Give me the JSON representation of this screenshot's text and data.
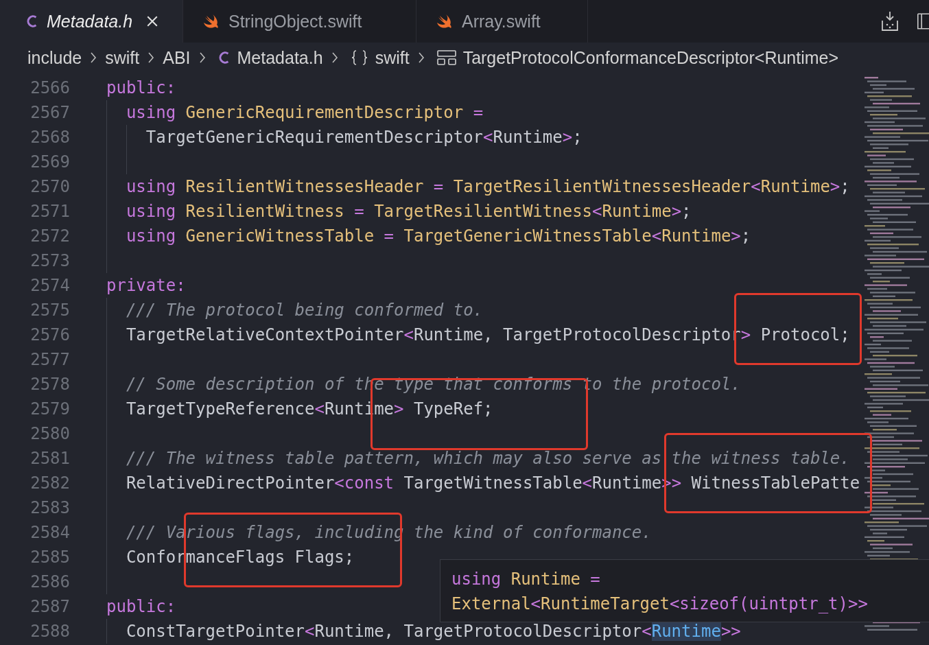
{
  "tabs": [
    {
      "label": "Metadata.h",
      "kind": "c-file",
      "selected": true
    },
    {
      "label": "StringObject.swift",
      "kind": "swift-file",
      "selected": false
    },
    {
      "label": "Array.swift",
      "kind": "swift-file",
      "selected": false
    }
  ],
  "breadcrumb": [
    {
      "label": "include",
      "kind": "folder"
    },
    {
      "label": "swift",
      "kind": "folder"
    },
    {
      "label": "ABI",
      "kind": "folder"
    },
    {
      "label": "Metadata.h",
      "kind": "c-file"
    },
    {
      "label": "swift",
      "kind": "namespace"
    },
    {
      "label": "TargetProtocolConformanceDescriptor<Runtime>",
      "kind": "struct"
    }
  ],
  "code_lines": [
    {
      "number": "2566",
      "tokens": [
        {
          "text": "public:",
          "kind": "keyword"
        }
      ]
    },
    {
      "number": "2567",
      "tokens": [
        {
          "text": "  using",
          "kind": "keyword"
        },
        {
          "text": " GenericRequirementDescriptor",
          "kind": "type"
        },
        {
          "text": " =",
          "kind": "operator"
        }
      ]
    },
    {
      "number": "2568",
      "tokens": [
        {
          "text": "    TargetGenericRequirementDescriptor",
          "kind": "plain"
        },
        {
          "text": "<",
          "kind": "operator"
        },
        {
          "text": "Runtime",
          "kind": "plain"
        },
        {
          "text": ">",
          "kind": "operator"
        },
        {
          "text": ";",
          "kind": "plain"
        }
      ]
    },
    {
      "number": "2569"
    },
    {
      "number": "2570",
      "tokens": [
        {
          "text": "  using",
          "kind": "keyword"
        },
        {
          "text": " ResilientWitnessesHeader",
          "kind": "type"
        },
        {
          "text": " = ",
          "kind": "operator"
        },
        {
          "text": "TargetResilientWitnessesHeader",
          "kind": "type"
        },
        {
          "text": "<",
          "kind": "operator"
        },
        {
          "text": "Runtime",
          "kind": "type"
        },
        {
          "text": ">",
          "kind": "operator"
        },
        {
          "text": ";",
          "kind": "plain"
        }
      ]
    },
    {
      "number": "2571",
      "tokens": [
        {
          "text": "  using",
          "kind": "keyword"
        },
        {
          "text": " ResilientWitness",
          "kind": "type"
        },
        {
          "text": " = ",
          "kind": "operator"
        },
        {
          "text": "TargetResilientWitness",
          "kind": "type"
        },
        {
          "text": "<",
          "kind": "operator"
        },
        {
          "text": "Runtime",
          "kind": "type"
        },
        {
          "text": ">",
          "kind": "operator"
        },
        {
          "text": ";",
          "kind": "plain"
        }
      ]
    },
    {
      "number": "2572",
      "tokens": [
        {
          "text": "  using",
          "kind": "keyword"
        },
        {
          "text": " GenericWitnessTable",
          "kind": "type"
        },
        {
          "text": " = ",
          "kind": "operator"
        },
        {
          "text": "TargetGenericWitnessTable",
          "kind": "type"
        },
        {
          "text": "<",
          "kind": "operator"
        },
        {
          "text": "Runtime",
          "kind": "type"
        },
        {
          "text": ">",
          "kind": "operator"
        },
        {
          "text": ";",
          "kind": "plain"
        }
      ]
    },
    {
      "number": "2573"
    },
    {
      "number": "2574",
      "tokens": [
        {
          "text": "private:",
          "kind": "keyword"
        }
      ]
    },
    {
      "number": "2575",
      "tokens": [
        {
          "text": "  /// The protocol being conformed to.",
          "kind": "comment"
        }
      ]
    },
    {
      "number": "2576",
      "tokens": [
        {
          "text": "  TargetRelativeContextPointer",
          "kind": "plain"
        },
        {
          "text": "<",
          "kind": "operator"
        },
        {
          "text": "Runtime, TargetProtocolDescriptor",
          "kind": "plain"
        },
        {
          "text": ">",
          "kind": "operator"
        },
        {
          "text": " Protocol;",
          "kind": "plain"
        }
      ]
    },
    {
      "number": "2577"
    },
    {
      "number": "2578",
      "tokens": [
        {
          "text": "  // Some description of the type that conforms to the protocol.",
          "kind": "comment"
        }
      ]
    },
    {
      "number": "2579",
      "tokens": [
        {
          "text": "  TargetTypeReference",
          "kind": "plain"
        },
        {
          "text": "<",
          "kind": "operator"
        },
        {
          "text": "Runtime",
          "kind": "plain"
        },
        {
          "text": ">",
          "kind": "operator"
        },
        {
          "text": " TypeRef;",
          "kind": "plain"
        }
      ]
    },
    {
      "number": "2580"
    },
    {
      "number": "2581",
      "tokens": [
        {
          "text": "  /// The witness table pattern, which may also serve as the witness table.",
          "kind": "comment"
        }
      ]
    },
    {
      "number": "2582",
      "tokens": [
        {
          "text": "  RelativeDirectPointer",
          "kind": "plain"
        },
        {
          "text": "<",
          "kind": "operator"
        },
        {
          "text": "const",
          "kind": "keyword"
        },
        {
          "text": " TargetWitnessTable",
          "kind": "plain"
        },
        {
          "text": "<",
          "kind": "operator"
        },
        {
          "text": "Runtime",
          "kind": "plain"
        },
        {
          "text": ">>",
          "kind": "operator"
        },
        {
          "text": " WitnessTablePatte",
          "kind": "plain"
        }
      ]
    },
    {
      "number": "2583"
    },
    {
      "number": "2584",
      "tokens": [
        {
          "text": "  /// Various flags, including the kind of conformance.",
          "kind": "comment"
        }
      ]
    },
    {
      "number": "2585",
      "tokens": [
        {
          "text": "  ConformanceFlags Flags;",
          "kind": "plain"
        }
      ]
    },
    {
      "number": "2586"
    },
    {
      "number": "2587",
      "tokens": [
        {
          "text": "public:",
          "kind": "keyword"
        }
      ]
    },
    {
      "number": "2588",
      "tokens": [
        {
          "text": "  ConstTargetPointer",
          "kind": "plain"
        },
        {
          "text": "<",
          "kind": "operator"
        },
        {
          "text": "Runtime, TargetProtocolDescriptor",
          "kind": "plain"
        },
        {
          "text": "<",
          "kind": "operator"
        },
        {
          "text": "Runtime",
          "kind": "highlight"
        },
        {
          "text": ">>",
          "kind": "operator"
        }
      ]
    }
  ],
  "hover_tooltip": [
    [
      {
        "text": "using",
        "kind": "keyword"
      },
      {
        "text": " Runtime",
        "kind": "type"
      },
      {
        "text": " =",
        "kind": "operator"
      }
    ],
    [
      {
        "text": "External",
        "kind": "type"
      },
      {
        "text": "<",
        "kind": "operator"
      },
      {
        "text": "RuntimeTarget",
        "kind": "type"
      },
      {
        "text": "<",
        "kind": "operator"
      },
      {
        "text": "sizeof",
        "kind": "keyword"
      },
      {
        "text": "(",
        "kind": "operator"
      },
      {
        "text": "uintptr_t",
        "kind": "keyword"
      },
      {
        "text": ")>>",
        "kind": "operator"
      }
    ]
  ]
}
